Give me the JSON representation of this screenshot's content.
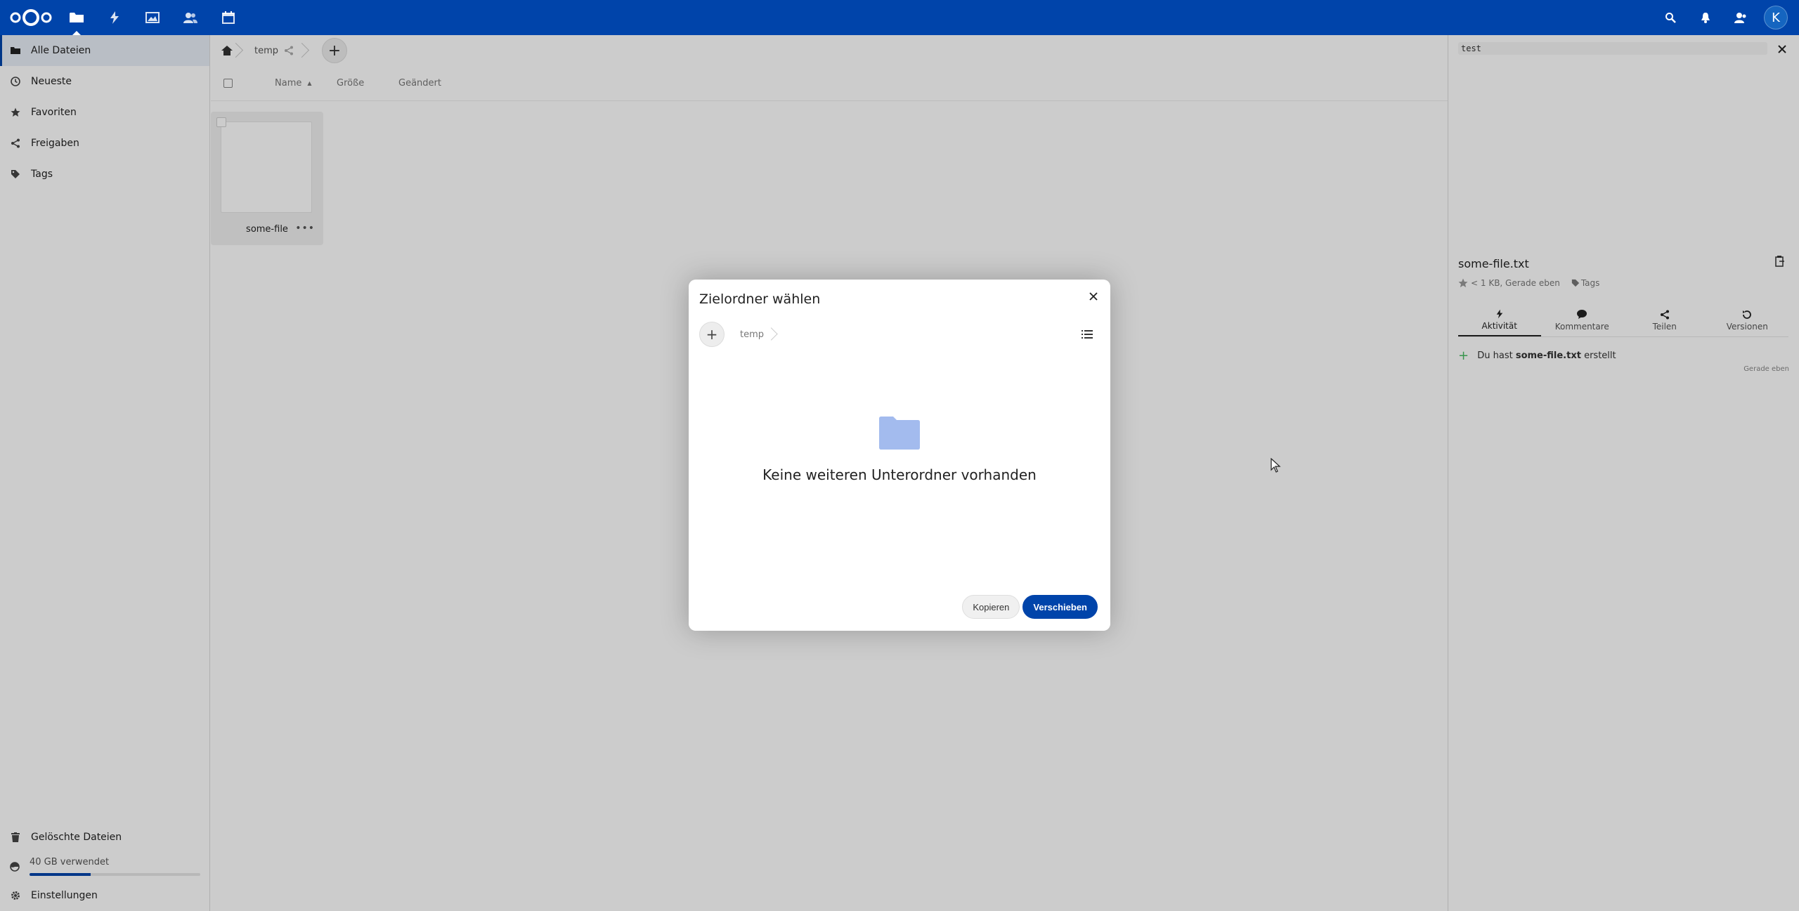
{
  "header": {
    "apps": [
      {
        "name": "files-app",
        "icon": "folder-icon",
        "active": true
      },
      {
        "name": "activity-app",
        "icon": "lightning-icon"
      },
      {
        "name": "photos-app",
        "icon": "image-icon"
      },
      {
        "name": "contacts-app",
        "icon": "contacts-icon"
      },
      {
        "name": "calendar-app",
        "icon": "calendar-icon"
      }
    ],
    "avatar_letter": "K",
    "brand_color": "#0044aa"
  },
  "sidebar": {
    "items": [
      {
        "label": "Alle Dateien",
        "icon": "folder-icon",
        "active": true
      },
      {
        "label": "Neueste",
        "icon": "clock-icon"
      },
      {
        "label": "Favoriten",
        "icon": "star-icon"
      },
      {
        "label": "Freigaben",
        "icon": "share-icon"
      },
      {
        "label": "Tags",
        "icon": "tag-icon"
      }
    ],
    "deleted_files": "Gelöschte Dateien",
    "quota_text": "40 GB verwendet",
    "quota_fraction": 0.36,
    "settings": "Einstellungen"
  },
  "main": {
    "breadcrumb": "temp",
    "columns": {
      "name": "Name",
      "size": "Größe",
      "modified": "Geändert"
    },
    "files": [
      {
        "name": "some-file"
      }
    ]
  },
  "details": {
    "tag_input": "test",
    "filename": "some-file.txt",
    "meta": "< 1 KB, Gerade eben",
    "tags_label": "Tags",
    "tabs": [
      {
        "label": "Aktivität",
        "icon": "lightning-icon",
        "active": true
      },
      {
        "label": "Kommentare",
        "icon": "comment-icon"
      },
      {
        "label": "Teilen",
        "icon": "share-icon"
      },
      {
        "label": "Versionen",
        "icon": "history-icon"
      }
    ],
    "activity": {
      "prefix": "Du hast",
      "file": "some-file.txt",
      "suffix": "erstellt",
      "time": "Gerade eben"
    }
  },
  "dialog": {
    "title": "Zielordner wählen",
    "breadcrumb": "temp",
    "empty_text": "Keine weiteren Unterordner vorhanden",
    "copy_label": "Kopieren",
    "move_label": "Verschieben"
  }
}
